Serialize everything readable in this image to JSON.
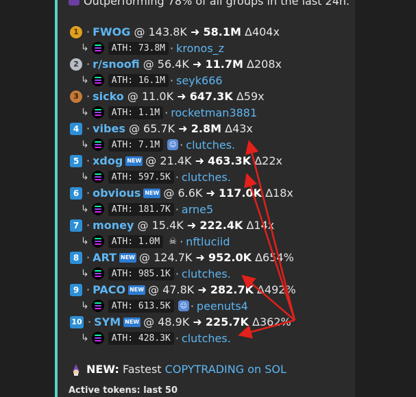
{
  "header": {
    "text": "Outperforming 78% of all groups in the last 24h."
  },
  "rows": [
    {
      "rank": "1",
      "token": "FWOG",
      "entry": "143.8K",
      "peak": "58.1M",
      "mult": "404x",
      "ath": "ATH: 73.8M",
      "user": "kronos_z"
    },
    {
      "rank": "2",
      "token": "r/snoofi",
      "entry": "56.4K",
      "peak": "11.7M",
      "mult": "208x",
      "ath": "ATH: 16.1M",
      "user": "seyk666"
    },
    {
      "rank": "3",
      "token": "sicko",
      "entry": "11.0K",
      "peak": "647.3K",
      "mult": "59x",
      "ath": "ATH: 1.1M",
      "user": "rocketman3881"
    },
    {
      "rank": "4",
      "token": "vibes",
      "entry": "65.7K",
      "peak": "2.8M",
      "mult": "43x",
      "ath": "ATH: 7.1M",
      "user": "clutches."
    },
    {
      "rank": "5",
      "token": "xdog",
      "entry": "21.4K",
      "peak": "463.3K",
      "mult": "22x",
      "ath": "ATH: 597.5K",
      "user": "clutches."
    },
    {
      "rank": "6",
      "token": "obvious",
      "entry": "6.6K",
      "peak": "117.0K",
      "mult": "18x",
      "ath": "ATH: 181.7K",
      "user": "arne5"
    },
    {
      "rank": "7",
      "token": "money",
      "entry": "15.4K",
      "peak": "222.4K",
      "mult": "14x",
      "ath": "ATH: 1.0M",
      "user": "nftluciid"
    },
    {
      "rank": "8",
      "token": "ART",
      "entry": "124.7K",
      "peak": "952.0K",
      "mult": "654%",
      "ath": "ATH: 985.1K",
      "user": "clutches."
    },
    {
      "rank": "9",
      "token": "PACO",
      "entry": "47.8K",
      "peak": "282.7K",
      "mult": "492%",
      "ath": "ATH: 613.5K",
      "user": "peenuts4"
    },
    {
      "rank": "10",
      "token": "SYM",
      "entry": "48.9K",
      "peak": "225.7K",
      "mult": "362%",
      "ath": "ATH: 428.3K",
      "user": "clutches."
    }
  ],
  "labels": {
    "sep": "·",
    "at": "@",
    "arrow": "➜",
    "delta": "Δ",
    "sub_arrow": "↳",
    "new_badge": "NEW"
  },
  "promo": {
    "label": "NEW:",
    "text": "Fastest",
    "link": "COPYTRADING on SOL"
  },
  "footer": {
    "text": "Active tokens: last 50"
  },
  "colors": {
    "accent": "#5ecfc4",
    "link": "#5eb6f2",
    "arrow": "#e3201b",
    "card": "#2b2b2b",
    "background": "#1f1f1f"
  }
}
